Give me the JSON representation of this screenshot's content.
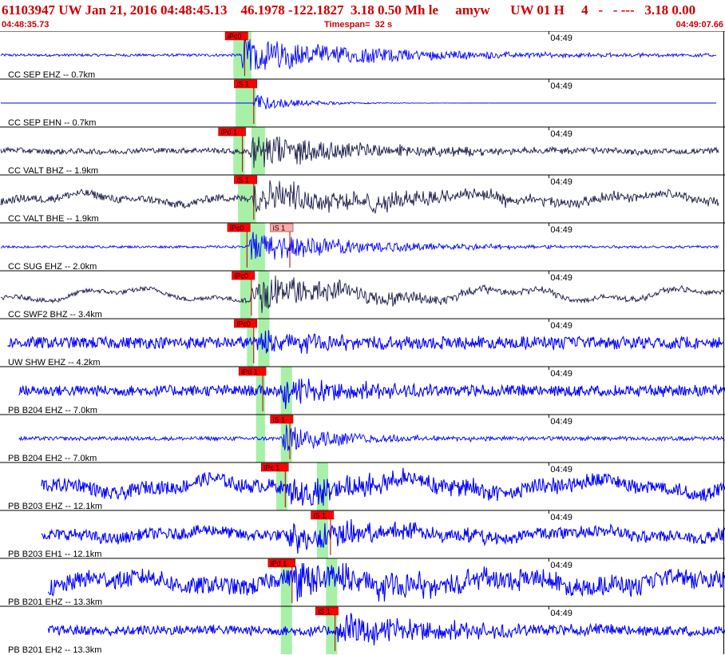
{
  "header": {
    "title": "61103947 UW Jan 21, 2016 04:48:45.13    46.1978 -122.1827  3.18 0.50 Mh le     amyw      UW 01 H     4   -   - ---   3.18 0.00",
    "start_time": "04:48:35.73",
    "timespan": "Timespan=  32 s",
    "end_time": "04:49:07.66"
  },
  "colors": {
    "trace_blue": "#0000ff",
    "trace_dark": "#1a1a4a",
    "pick_red": "#ff0000",
    "pick_pink": "#ffaaaa",
    "band_green": "#a8f0a8",
    "header_red": "#cc0000"
  },
  "chart_data": {
    "type": "line",
    "title": "61103947 UW Jan 21, 2016 04:48:45.13",
    "x_start": "04:48:35.73",
    "x_end": "04:49:07.66",
    "timespan_s": 32,
    "tick_label": "04:49",
    "tick_time_s": 24.27,
    "grid": false,
    "series": [
      {
        "name": "CC SEP EHZ -- 0.7km",
        "style": "blue",
        "trace_start_s": 0.0,
        "trace_end_s": 31.7,
        "noise": 0.07,
        "shake_amp": 0.95,
        "shake_start_s": 10.6,
        "shake_decay_s": 6,
        "low_freq": 0.0,
        "picks": [
          {
            "label": "iPc0",
            "t_s": 10.8,
            "tag_color": "red"
          }
        ],
        "bands": [
          [
            10.3,
            11.1
          ]
        ]
      },
      {
        "name": "CC SEP EHN -- 0.7km",
        "style": "blue",
        "trace_start_s": 0.0,
        "trace_end_s": 31.7,
        "noise": 0.0,
        "shake_amp": 0.45,
        "shake_start_s": 11.2,
        "shake_decay_s": 2,
        "low_freq": 0.0,
        "picks": [
          {
            "label": "iS 1",
            "t_s": 11.2,
            "tag_color": "red"
          }
        ],
        "bands": [
          [
            10.4,
            11.3
          ]
        ]
      },
      {
        "name": "CC VALT BHZ -- 1.9km",
        "style": "dark",
        "trace_start_s": 0.0,
        "trace_end_s": 31.8,
        "noise": 0.14,
        "shake_amp": 0.9,
        "shake_start_s": 11.0,
        "shake_decay_s": 5,
        "low_freq": 0.05,
        "picks": [
          {
            "label": "iPd 1",
            "t_s": 10.7,
            "tag_color": "red"
          }
        ],
        "bands": [
          [
            10.3,
            10.8
          ],
          [
            11.1,
            11.7
          ]
        ]
      },
      {
        "name": "CC VALT BHE -- 1.9km",
        "style": "dark",
        "trace_start_s": 0.0,
        "trace_end_s": 31.8,
        "noise": 0.2,
        "shake_amp": 0.75,
        "shake_start_s": 11.2,
        "shake_decay_s": 8,
        "low_freq": 0.25,
        "picks": [
          {
            "label": "iS 1",
            "t_s": 11.2,
            "tag_color": "red"
          }
        ],
        "bands": [
          [
            10.5,
            11.3
          ]
        ]
      },
      {
        "name": "CC SUG EHZ -- 2.0km",
        "style": "blue",
        "trace_start_s": 0.0,
        "trace_end_s": 31.8,
        "noise": 0.06,
        "shake_amp": 0.85,
        "shake_start_s": 11.0,
        "shake_decay_s": 5,
        "low_freq": 0.0,
        "picks": [
          {
            "label": "iPc0",
            "t_s": 10.9,
            "tag_color": "red"
          },
          {
            "label": "iS 1",
            "t_s": 12.8,
            "tag_color": "pink"
          }
        ],
        "bands": [
          [
            10.6,
            11.1
          ],
          [
            11.1,
            11.7
          ]
        ]
      },
      {
        "name": "CC SWF2 BHZ -- 3.4km",
        "style": "dark",
        "trace_start_s": 0.0,
        "trace_end_s": 32.0,
        "noise": 0.12,
        "shake_amp": 0.85,
        "shake_start_s": 11.1,
        "shake_decay_s": 6,
        "low_freq": 0.32,
        "picks": [
          {
            "label": "iPc0",
            "t_s": 11.1,
            "tag_color": "red"
          }
        ],
        "bands": [
          [
            10.6,
            11.1
          ],
          [
            11.4,
            11.9
          ]
        ]
      },
      {
        "name": "UW SHW EHZ -- 4.2km",
        "style": "blue",
        "trace_start_s": 0.3,
        "trace_end_s": 32.0,
        "noise": 0.3,
        "shake_amp": 0.55,
        "shake_start_s": 11.3,
        "shake_decay_s": 3,
        "low_freq": 0.0,
        "picks": [
          {
            "label": "iPc0",
            "t_s": 11.2,
            "tag_color": "red"
          }
        ],
        "bands": [
          [
            10.9,
            11.2
          ],
          [
            11.4,
            11.9
          ]
        ]
      },
      {
        "name": "PB B204 EHZ -- 7.0km",
        "style": "blue",
        "trace_start_s": 0.8,
        "trace_end_s": 32.6,
        "noise": 0.28,
        "shake_amp": 0.8,
        "shake_start_s": 12.4,
        "shake_decay_s": 3,
        "low_freq": 0.0,
        "picks": [
          {
            "label": "iPd 1",
            "t_s": 11.6,
            "tag_color": "red"
          }
        ],
        "bands": [
          [
            11.3,
            11.7
          ],
          [
            12.4,
            12.9
          ]
        ]
      },
      {
        "name": "PB B204 EH2 -- 7.0km",
        "style": "blue",
        "trace_start_s": 0.8,
        "trace_end_s": 32.6,
        "noise": 0.1,
        "shake_amp": 0.75,
        "shake_start_s": 12.5,
        "shake_decay_s": 3,
        "low_freq": 0.0,
        "picks": [
          {
            "label": "iS 1",
            "t_s": 12.8,
            "tag_color": "red"
          }
        ],
        "bands": [
          [
            11.3,
            11.7
          ],
          [
            12.4,
            12.9
          ]
        ]
      },
      {
        "name": "PB B203 EHZ -- 12.1km",
        "style": "blue",
        "trace_start_s": 1.8,
        "trace_end_s": 33.6,
        "noise": 0.35,
        "shake_amp": 0.7,
        "shake_start_s": 12.7,
        "shake_decay_s": 6,
        "low_freq": 0.35,
        "picks": [
          {
            "label": "iPc 1",
            "t_s": 12.6,
            "tag_color": "red"
          }
        ],
        "bands": [
          [
            12.2,
            12.7
          ],
          [
            14.0,
            14.5
          ]
        ]
      },
      {
        "name": "PB B203 EH1 -- 12.1km",
        "style": "blue",
        "trace_start_s": 1.8,
        "trace_end_s": 33.6,
        "noise": 0.3,
        "shake_amp": 0.7,
        "shake_start_s": 12.7,
        "shake_decay_s": 5,
        "low_freq": 0.2,
        "picks": [
          {
            "label": "iS 1",
            "t_s": 14.6,
            "tag_color": "red"
          }
        ],
        "bands": [
          [
            14.0,
            14.5
          ]
        ]
      },
      {
        "name": "PB B201 EHZ -- 13.3km",
        "style": "blue",
        "trace_start_s": 2.1,
        "trace_end_s": 33.6,
        "noise": 0.45,
        "shake_amp": 0.8,
        "shake_start_s": 12.9,
        "shake_decay_s": 6,
        "low_freq": 0.3,
        "picks": [
          {
            "label": "iPd 1",
            "t_s": 12.9,
            "tag_color": "red"
          }
        ],
        "bands": [
          [
            12.4,
            12.9
          ],
          [
            14.4,
            14.9
          ]
        ]
      },
      {
        "name": "PB B201 EH2 -- 13.3km",
        "style": "blue",
        "trace_start_s": 2.1,
        "trace_end_s": 33.6,
        "noise": 0.25,
        "shake_amp": 0.85,
        "shake_start_s": 14.9,
        "shake_decay_s": 5,
        "low_freq": 0.05,
        "picks": [
          {
            "label": "iS 1",
            "t_s": 14.8,
            "tag_color": "red"
          }
        ],
        "bands": [
          [
            12.4,
            12.9
          ],
          [
            14.4,
            14.9
          ]
        ]
      }
    ]
  }
}
